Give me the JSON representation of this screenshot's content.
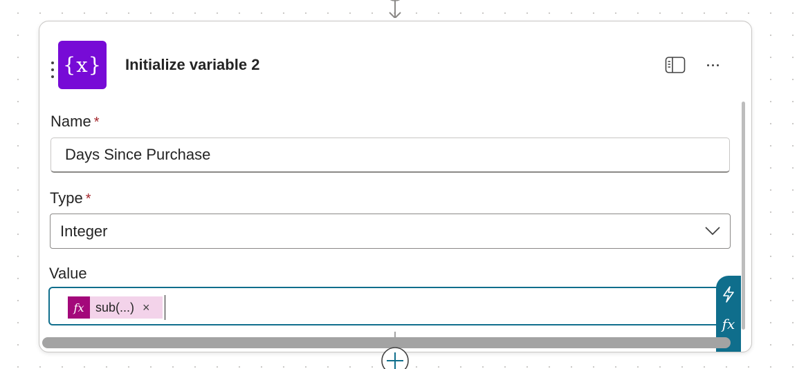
{
  "card": {
    "title": "Initialize variable 2",
    "icon_text": "{x}",
    "icon_color": "#770bd6"
  },
  "fields": {
    "name_label": "Name",
    "name_required": "*",
    "name_value": "Days Since Purchase",
    "type_label": "Type",
    "type_required": "*",
    "type_value": "Integer",
    "value_label": "Value"
  },
  "token": {
    "icon_text": "fx",
    "label": "sub(...)",
    "remove_symbol": "×",
    "color": "#a3087a"
  },
  "side_panel": {
    "fx_text": "fx",
    "color": "#0f6e8c"
  },
  "icons": {
    "drag_handle": "drag-handle-icon",
    "panel": "panel-icon",
    "more": "more-options-icon",
    "chevron": "chevron-down-icon",
    "dynamic_content": "lightning-icon",
    "expression": "fx-icon",
    "add_step": "plus-icon",
    "arrow": "arrow-down-icon"
  }
}
